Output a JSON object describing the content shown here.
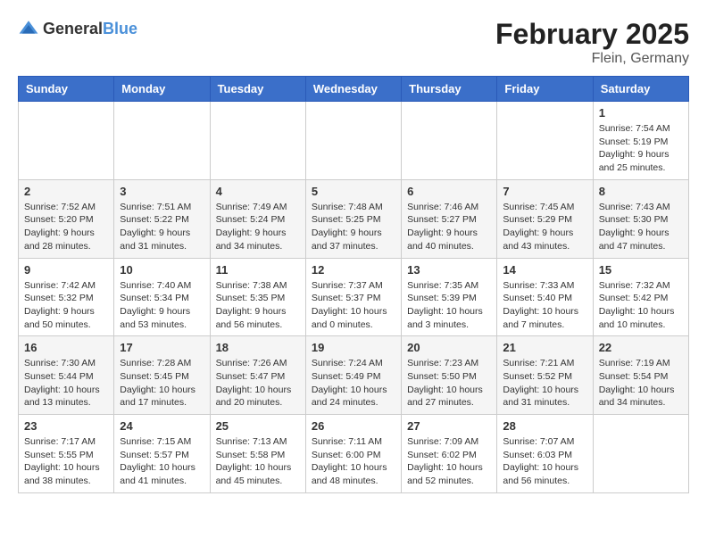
{
  "header": {
    "logo_general": "General",
    "logo_blue": "Blue",
    "month_year": "February 2025",
    "location": "Flein, Germany"
  },
  "days_of_week": [
    "Sunday",
    "Monday",
    "Tuesday",
    "Wednesday",
    "Thursday",
    "Friday",
    "Saturday"
  ],
  "weeks": [
    [
      {
        "day": "",
        "info": ""
      },
      {
        "day": "",
        "info": ""
      },
      {
        "day": "",
        "info": ""
      },
      {
        "day": "",
        "info": ""
      },
      {
        "day": "",
        "info": ""
      },
      {
        "day": "",
        "info": ""
      },
      {
        "day": "1",
        "info": "Sunrise: 7:54 AM\nSunset: 5:19 PM\nDaylight: 9 hours and 25 minutes."
      }
    ],
    [
      {
        "day": "2",
        "info": "Sunrise: 7:52 AM\nSunset: 5:20 PM\nDaylight: 9 hours and 28 minutes."
      },
      {
        "day": "3",
        "info": "Sunrise: 7:51 AM\nSunset: 5:22 PM\nDaylight: 9 hours and 31 minutes."
      },
      {
        "day": "4",
        "info": "Sunrise: 7:49 AM\nSunset: 5:24 PM\nDaylight: 9 hours and 34 minutes."
      },
      {
        "day": "5",
        "info": "Sunrise: 7:48 AM\nSunset: 5:25 PM\nDaylight: 9 hours and 37 minutes."
      },
      {
        "day": "6",
        "info": "Sunrise: 7:46 AM\nSunset: 5:27 PM\nDaylight: 9 hours and 40 minutes."
      },
      {
        "day": "7",
        "info": "Sunrise: 7:45 AM\nSunset: 5:29 PM\nDaylight: 9 hours and 43 minutes."
      },
      {
        "day": "8",
        "info": "Sunrise: 7:43 AM\nSunset: 5:30 PM\nDaylight: 9 hours and 47 minutes."
      }
    ],
    [
      {
        "day": "9",
        "info": "Sunrise: 7:42 AM\nSunset: 5:32 PM\nDaylight: 9 hours and 50 minutes."
      },
      {
        "day": "10",
        "info": "Sunrise: 7:40 AM\nSunset: 5:34 PM\nDaylight: 9 hours and 53 minutes."
      },
      {
        "day": "11",
        "info": "Sunrise: 7:38 AM\nSunset: 5:35 PM\nDaylight: 9 hours and 56 minutes."
      },
      {
        "day": "12",
        "info": "Sunrise: 7:37 AM\nSunset: 5:37 PM\nDaylight: 10 hours and 0 minutes."
      },
      {
        "day": "13",
        "info": "Sunrise: 7:35 AM\nSunset: 5:39 PM\nDaylight: 10 hours and 3 minutes."
      },
      {
        "day": "14",
        "info": "Sunrise: 7:33 AM\nSunset: 5:40 PM\nDaylight: 10 hours and 7 minutes."
      },
      {
        "day": "15",
        "info": "Sunrise: 7:32 AM\nSunset: 5:42 PM\nDaylight: 10 hours and 10 minutes."
      }
    ],
    [
      {
        "day": "16",
        "info": "Sunrise: 7:30 AM\nSunset: 5:44 PM\nDaylight: 10 hours and 13 minutes."
      },
      {
        "day": "17",
        "info": "Sunrise: 7:28 AM\nSunset: 5:45 PM\nDaylight: 10 hours and 17 minutes."
      },
      {
        "day": "18",
        "info": "Sunrise: 7:26 AM\nSunset: 5:47 PM\nDaylight: 10 hours and 20 minutes."
      },
      {
        "day": "19",
        "info": "Sunrise: 7:24 AM\nSunset: 5:49 PM\nDaylight: 10 hours and 24 minutes."
      },
      {
        "day": "20",
        "info": "Sunrise: 7:23 AM\nSunset: 5:50 PM\nDaylight: 10 hours and 27 minutes."
      },
      {
        "day": "21",
        "info": "Sunrise: 7:21 AM\nSunset: 5:52 PM\nDaylight: 10 hours and 31 minutes."
      },
      {
        "day": "22",
        "info": "Sunrise: 7:19 AM\nSunset: 5:54 PM\nDaylight: 10 hours and 34 minutes."
      }
    ],
    [
      {
        "day": "23",
        "info": "Sunrise: 7:17 AM\nSunset: 5:55 PM\nDaylight: 10 hours and 38 minutes."
      },
      {
        "day": "24",
        "info": "Sunrise: 7:15 AM\nSunset: 5:57 PM\nDaylight: 10 hours and 41 minutes."
      },
      {
        "day": "25",
        "info": "Sunrise: 7:13 AM\nSunset: 5:58 PM\nDaylight: 10 hours and 45 minutes."
      },
      {
        "day": "26",
        "info": "Sunrise: 7:11 AM\nSunset: 6:00 PM\nDaylight: 10 hours and 48 minutes."
      },
      {
        "day": "27",
        "info": "Sunrise: 7:09 AM\nSunset: 6:02 PM\nDaylight: 10 hours and 52 minutes."
      },
      {
        "day": "28",
        "info": "Sunrise: 7:07 AM\nSunset: 6:03 PM\nDaylight: 10 hours and 56 minutes."
      },
      {
        "day": "",
        "info": ""
      }
    ]
  ]
}
